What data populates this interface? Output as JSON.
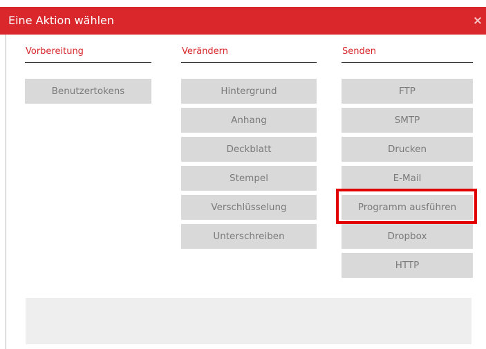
{
  "dialog": {
    "title": "Eine Aktion wählen",
    "close_glyph": "×"
  },
  "columns": [
    {
      "header": "Vorbereitung",
      "buttons": [
        "Benutzertokens"
      ]
    },
    {
      "header": "Verändern",
      "buttons": [
        "Hintergrund",
        "Anhang",
        "Deckblatt",
        "Stempel",
        "Verschlüsselung",
        "Unterschreiben"
      ]
    },
    {
      "header": "Senden",
      "buttons": [
        "FTP",
        "SMTP",
        "Drucken",
        "E-Mail",
        "Programm ausführen",
        "Dropbox",
        "HTTP"
      ]
    }
  ],
  "highlighted_action": "Programm ausführen",
  "colors": {
    "accent": "#d9272b",
    "button_bg": "#d9d9d9",
    "button_text": "#7a7a7a",
    "highlight_box": "#e00000"
  }
}
